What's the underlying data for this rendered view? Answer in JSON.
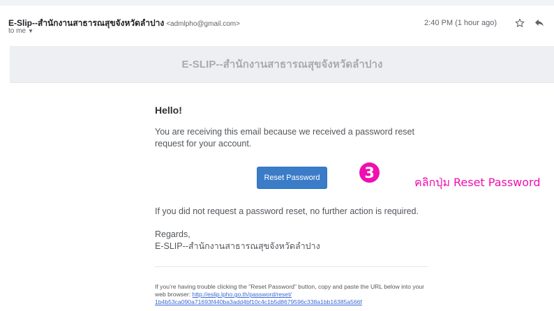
{
  "email": {
    "sender_name": "E-Slip--สำนักงานสาธารณสุขจังหวัดลำปาง",
    "sender_email": "<admlpho@gmail.com>",
    "recipient": "to me",
    "timestamp": "2:40 PM (1 hour ago)",
    "icons": {
      "star": "star-icon",
      "reply": "reply-icon",
      "recipient_menu": "caret-down-icon"
    }
  },
  "message": {
    "banner_title": "E-SLIP--สำนักงานสาธารณสุขจังหวัดลำปาง",
    "greeting": "Hello!",
    "intro": "You are receiving this email because we received a password reset request for your account.",
    "button_label": "Reset Password",
    "outro": "If you did not request a password reset, no further action is required.",
    "regards": "Regards,",
    "signature": "E-SLIP--สำนักงานสาธารณสุขจังหวัดลำปาง",
    "subcopy_text": "If you’re having trouble clicking the \"Reset Password\" button, copy and paste the URL below into your web browser:",
    "reset_url_line1": "http://eslip.lpho.go.th/password/reset/",
    "reset_url_line2": "1b4b53ca090a71693f440ba3add4bf10c4c1b5d8679596c338a1bb16385a566f"
  },
  "annotation": {
    "step_number": "3",
    "instruction": "คลิกปุ่ม Reset Password",
    "color": "#ef0eb0"
  },
  "colors": {
    "button": "#3b7cc8",
    "banner_bg": "#edeff2",
    "link": "#3869d4"
  }
}
